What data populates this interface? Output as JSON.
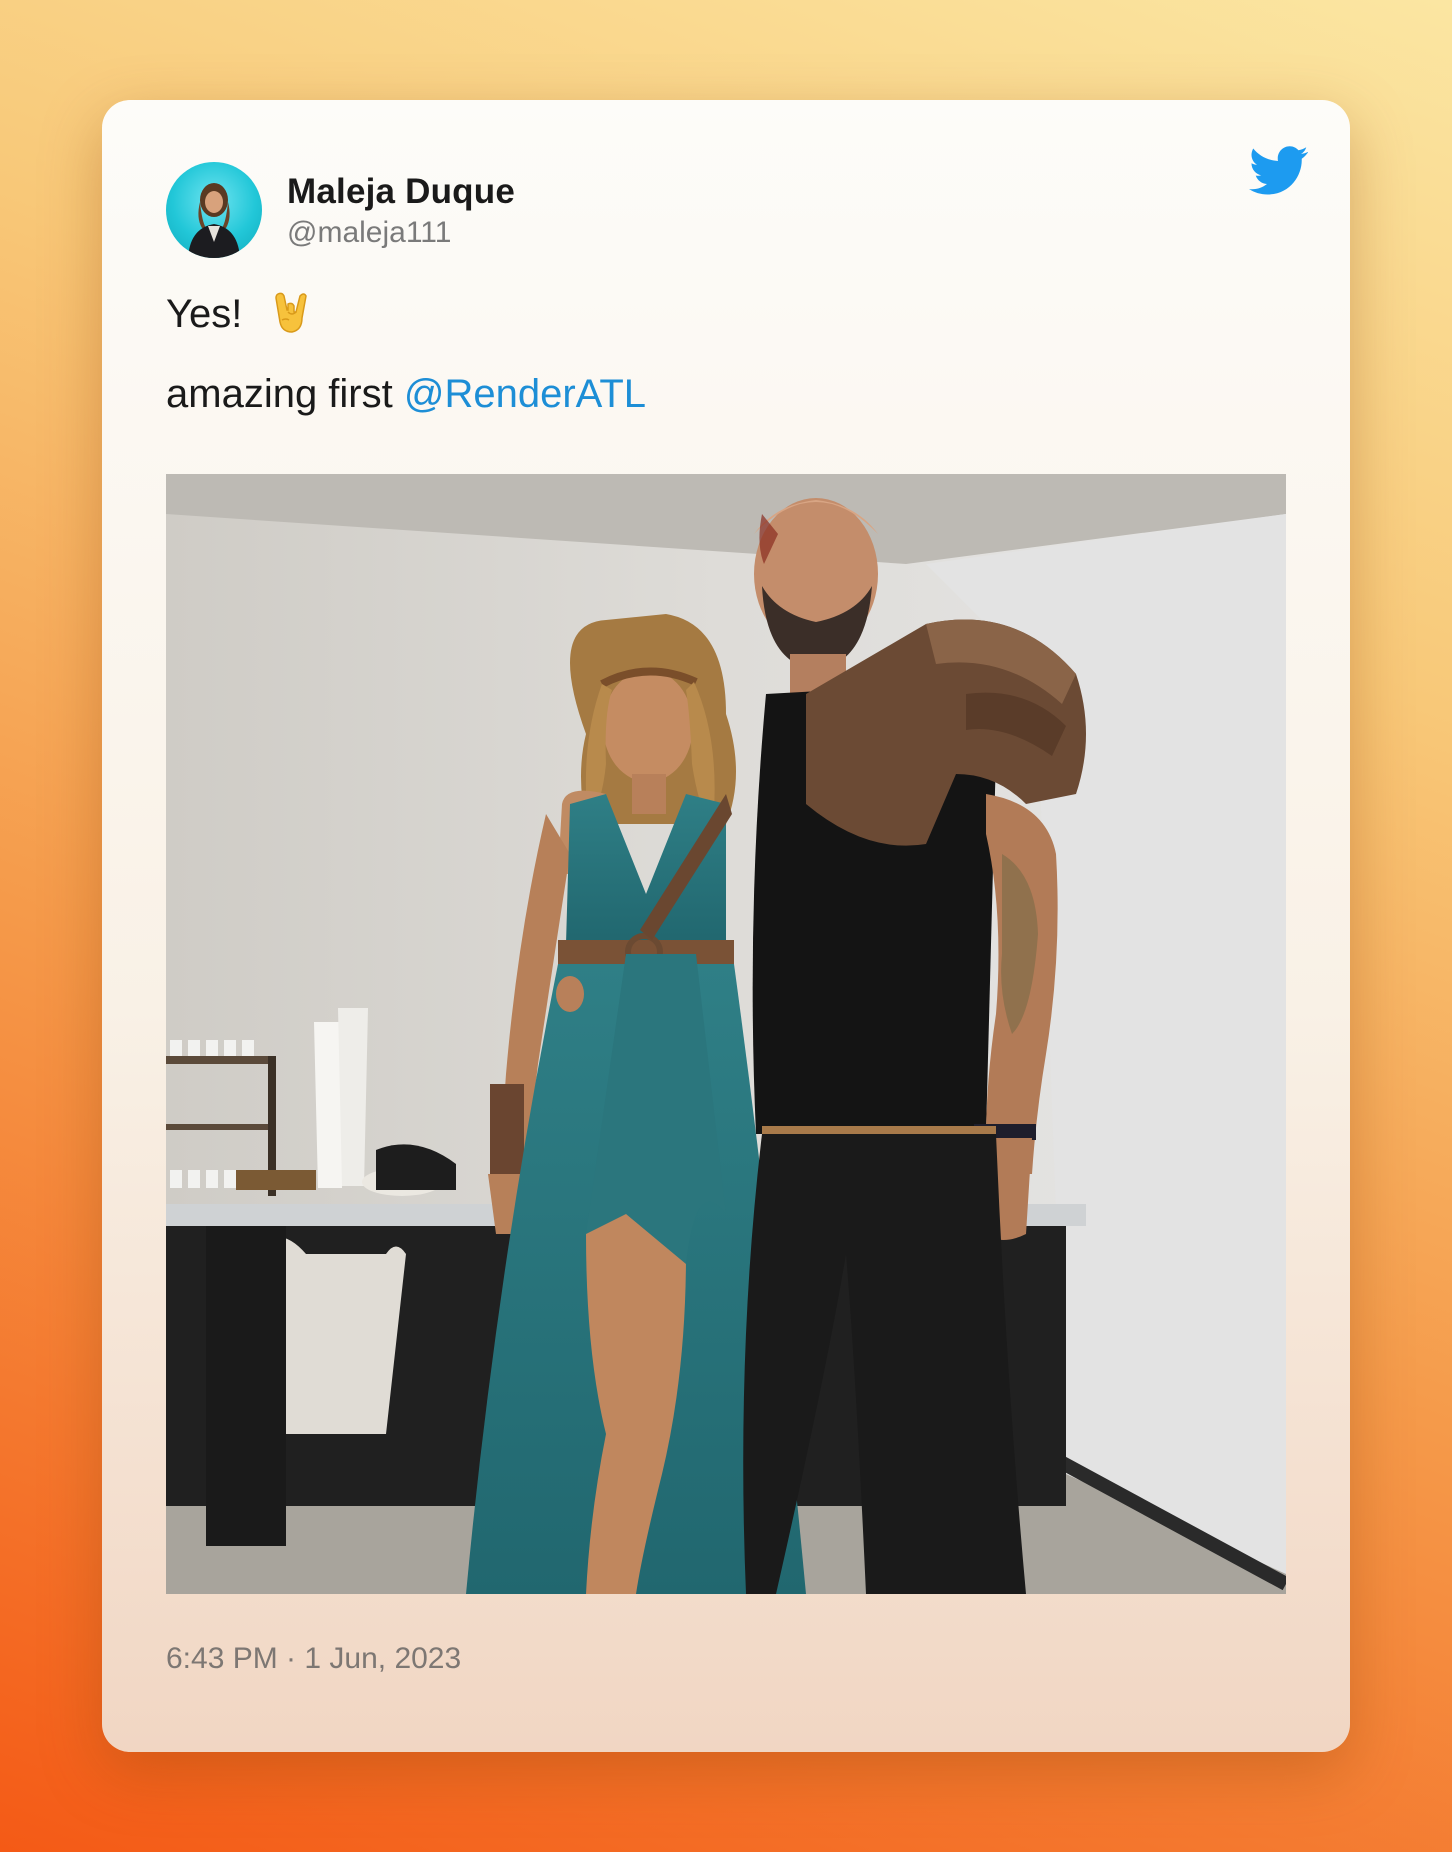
{
  "tweet": {
    "author_name": "Maleja Duque",
    "author_handle": "@maleja111",
    "text_line1": "Yes!",
    "text_line1_emoji": "sign-of-horns-emoji",
    "text_line2_prefix": "amazing first ",
    "mention": "@RenderATL",
    "timestamp": "6:43 PM · 1 Jun, 2023"
  },
  "colors": {
    "brand": "#1d9bf0",
    "mention": "#1d8ed6",
    "text": "#1a1a1a",
    "muted": "#7a7a7a"
  },
  "icons": {
    "brand": "twitter-bird-icon"
  }
}
